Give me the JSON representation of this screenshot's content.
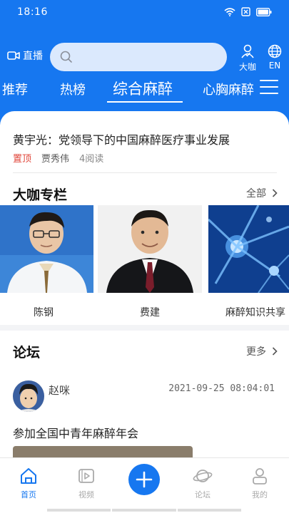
{
  "status_bar": {
    "time": "18:16"
  },
  "header": {
    "live_label": "直播",
    "search_placeholder": "",
    "expert_label": "大咖",
    "lang_label": "EN"
  },
  "tabs": [
    {
      "label": "推荐"
    },
    {
      "label": "热榜"
    },
    {
      "label": "综合麻醉",
      "active": true
    },
    {
      "label": "心胸麻醉"
    }
  ],
  "headline": {
    "title": "黄宇光：党领导下的中国麻醉医疗事业发展",
    "pin_label": "置顶",
    "author": "贾秀伟",
    "reads": "4阅读"
  },
  "experts_section": {
    "title": "大咖专栏",
    "more_label": "全部",
    "items": [
      {
        "name": "陈钢"
      },
      {
        "name": "费建"
      },
      {
        "name": "麻醉知识共享"
      }
    ]
  },
  "forum_section": {
    "title": "论坛",
    "more_label": "更多",
    "post": {
      "user": "赵咪",
      "time": "2021-09-25 08:04:01",
      "title": "参加全国中青年麻醉年会"
    }
  },
  "bottom_nav": {
    "items": [
      {
        "label": "首页",
        "icon": "home-icon",
        "active": true
      },
      {
        "label": "视频",
        "icon": "video-icon"
      },
      {
        "label": "论坛",
        "icon": "planet-icon"
      },
      {
        "label": "我的",
        "icon": "profile-icon"
      }
    ]
  },
  "colors": {
    "primary": "#1677f0",
    "pin": "#e0463a"
  }
}
